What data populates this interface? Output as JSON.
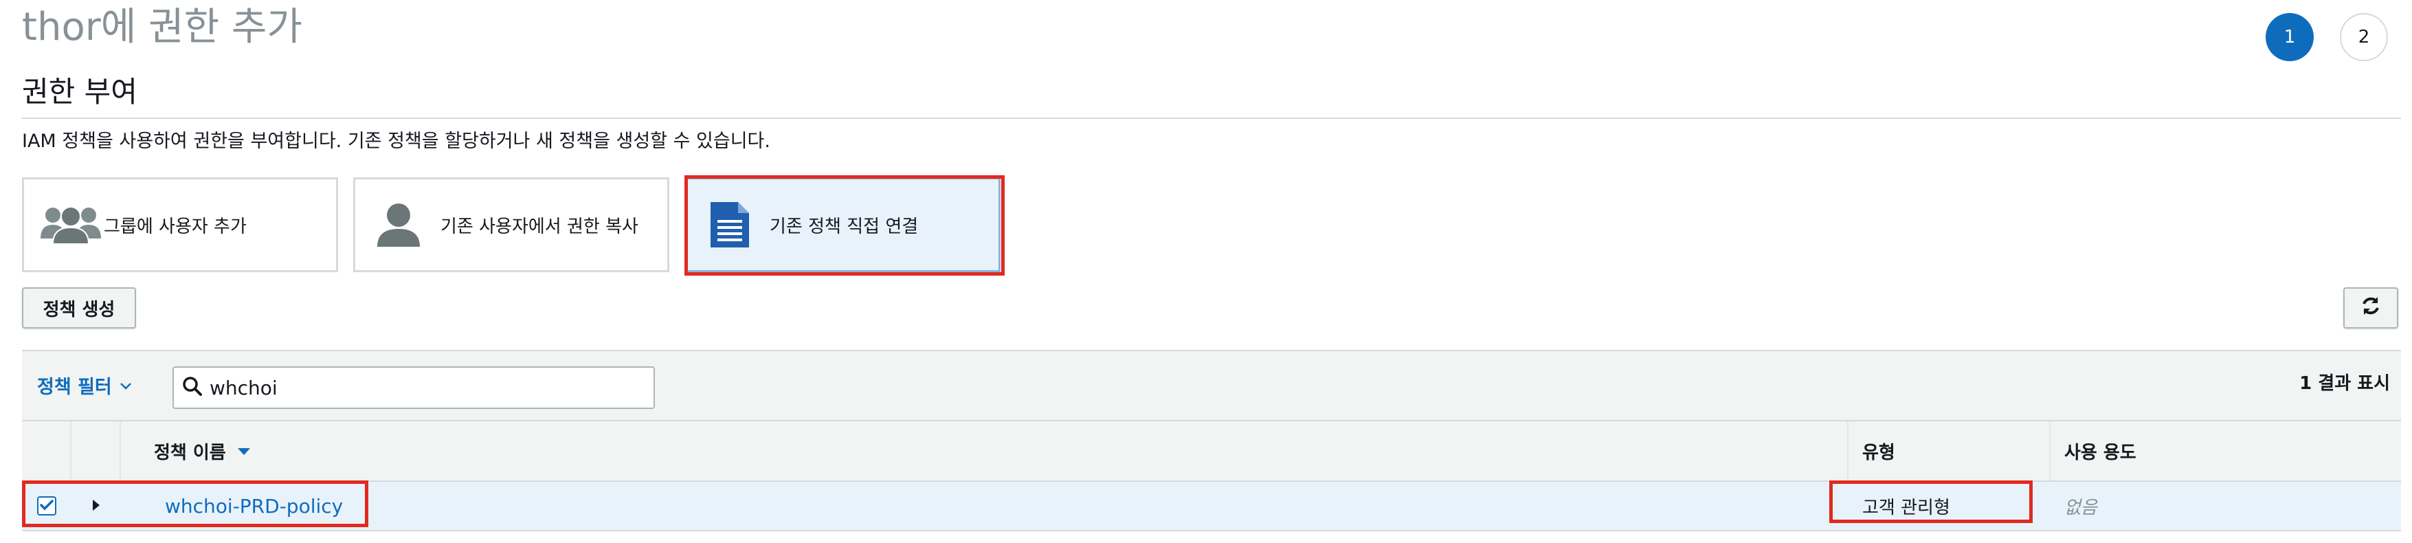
{
  "page": {
    "title": "thor에 권한 추가"
  },
  "steps": [
    "1",
    "2"
  ],
  "section": {
    "title": "권한 부여",
    "description": "IAM 정책을 사용하여 권한을 부여합니다. 기존 정책을 할당하거나 새 정책을 생성할 수 있습니다."
  },
  "options": [
    {
      "label": "그룹에 사용자 추가",
      "icon": "users-group-icon"
    },
    {
      "label": "기존 사용자에서 권한 복사",
      "icon": "user-icon"
    },
    {
      "label": "기존 정책 직접 연결",
      "icon": "document-icon",
      "selected": true
    }
  ],
  "toolbar": {
    "create_policy_label": "정책 생성",
    "refresh_icon": "refresh-icon"
  },
  "filter": {
    "label": "정책 필터",
    "search_value": "whchoi",
    "result_count": "1 결과 표시"
  },
  "table": {
    "columns": {
      "name": "정책 이름",
      "type": "유형",
      "usage": "사용 용도"
    },
    "rows": [
      {
        "checked": true,
        "name": "whchoi-PRD-policy",
        "type": "고객 관리형",
        "usage": "없음"
      }
    ]
  },
  "colors": {
    "accent": "#0f6cbd",
    "highlight": "#e12a1f",
    "selected_bg": "#e8f2fb"
  }
}
